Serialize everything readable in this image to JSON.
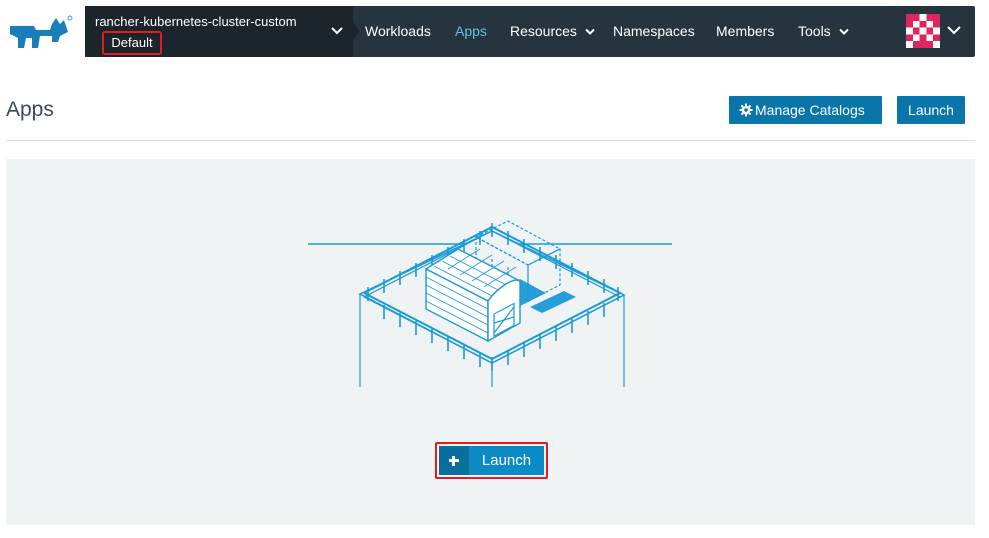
{
  "header": {
    "cluster_name": "rancher-kubernetes-cluster-custom",
    "project_name": "Default",
    "nav": [
      {
        "label": "Workloads",
        "has_dropdown": false,
        "active": false
      },
      {
        "label": "Apps",
        "has_dropdown": false,
        "active": true
      },
      {
        "label": "Resources",
        "has_dropdown": true,
        "active": false
      },
      {
        "label": "Namespaces",
        "has_dropdown": false,
        "active": false
      },
      {
        "label": "Members",
        "has_dropdown": false,
        "active": false
      },
      {
        "label": "Tools",
        "has_dropdown": true,
        "active": false
      }
    ],
    "icons": {
      "logo": "rancher-logo",
      "user": "user-avatar-icon"
    }
  },
  "page": {
    "title": "Apps",
    "manage_catalogs_label": "Manage Catalogs",
    "launch_label": "Launch"
  },
  "empty_state": {
    "launch_label": "Launch",
    "illustration": "barn-farm-illustration"
  },
  "colors": {
    "topbar": "#25343d",
    "cluster_bg": "#1b252b",
    "active_nav": "#67c2e6",
    "primary_button": "#0a75a9",
    "highlight": "#e31b23",
    "illustration": "#1a9ad6"
  }
}
